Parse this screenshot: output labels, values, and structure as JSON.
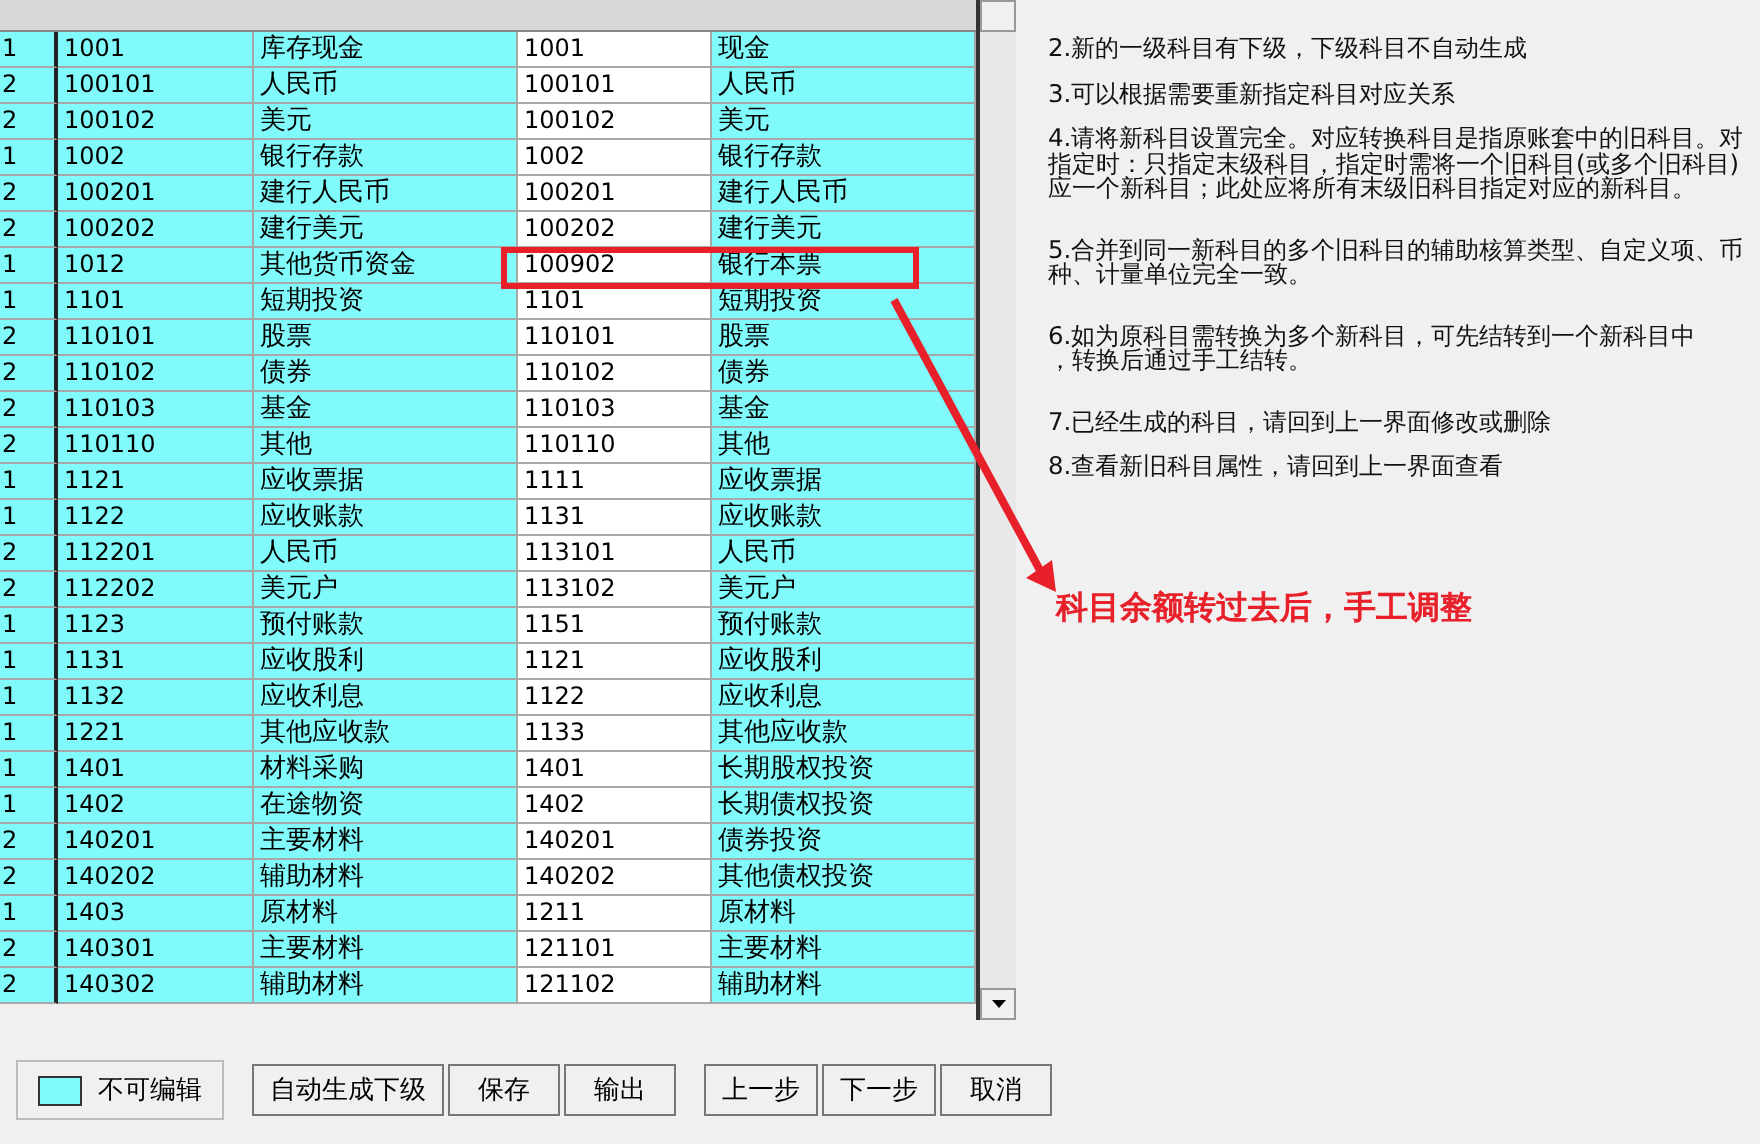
{
  "table": {
    "rows": [
      {
        "level": "1",
        "old_code": "1001",
        "old_name": "库存现金",
        "new_code": "1001",
        "new_name": "现金",
        "highlighted": false
      },
      {
        "level": "2",
        "old_code": "100101",
        "old_name": "人民币",
        "new_code": "100101",
        "new_name": "人民币",
        "highlighted": false
      },
      {
        "level": "2",
        "old_code": "100102",
        "old_name": "美元",
        "new_code": "100102",
        "new_name": "美元",
        "highlighted": false
      },
      {
        "level": "1",
        "old_code": "1002",
        "old_name": "银行存款",
        "new_code": "1002",
        "new_name": "银行存款",
        "highlighted": false
      },
      {
        "level": "2",
        "old_code": "100201",
        "old_name": "建行人民币",
        "new_code": "100201",
        "new_name": "建行人民币",
        "highlighted": false
      },
      {
        "level": "2",
        "old_code": "100202",
        "old_name": "建行美元",
        "new_code": "100202",
        "new_name": "建行美元",
        "highlighted": false
      },
      {
        "level": "1",
        "old_code": "1012",
        "old_name": "其他货币资金",
        "new_code": "100902",
        "new_name": "银行本票",
        "highlighted": true
      },
      {
        "level": "1",
        "old_code": "1101",
        "old_name": "短期投资",
        "new_code": "1101",
        "new_name": "短期投资",
        "highlighted": false
      },
      {
        "level": "2",
        "old_code": "110101",
        "old_name": "股票",
        "new_code": "110101",
        "new_name": "股票",
        "highlighted": false
      },
      {
        "level": "2",
        "old_code": "110102",
        "old_name": "债券",
        "new_code": "110102",
        "new_name": "债券",
        "highlighted": false
      },
      {
        "level": "2",
        "old_code": "110103",
        "old_name": "基金",
        "new_code": "110103",
        "new_name": "基金",
        "highlighted": false
      },
      {
        "level": "2",
        "old_code": "110110",
        "old_name": "其他",
        "new_code": "110110",
        "new_name": "其他",
        "highlighted": false
      },
      {
        "level": "1",
        "old_code": "1121",
        "old_name": "应收票据",
        "new_code": "1111",
        "new_name": "应收票据",
        "highlighted": false
      },
      {
        "level": "1",
        "old_code": "1122",
        "old_name": "应收账款",
        "new_code": "1131",
        "new_name": "应收账款",
        "highlighted": false
      },
      {
        "level": "2",
        "old_code": "112201",
        "old_name": "人民币",
        "new_code": "113101",
        "new_name": "人民币",
        "highlighted": false
      },
      {
        "level": "2",
        "old_code": "112202",
        "old_name": "美元户",
        "new_code": "113102",
        "new_name": "美元户",
        "highlighted": false
      },
      {
        "level": "1",
        "old_code": "1123",
        "old_name": "预付账款",
        "new_code": "1151",
        "new_name": "预付账款",
        "highlighted": false
      },
      {
        "level": "1",
        "old_code": "1131",
        "old_name": "应收股利",
        "new_code": "1121",
        "new_name": "应收股利",
        "highlighted": false
      },
      {
        "level": "1",
        "old_code": "1132",
        "old_name": "应收利息",
        "new_code": "1122",
        "new_name": "应收利息",
        "highlighted": false
      },
      {
        "level": "1",
        "old_code": "1221",
        "old_name": "其他应收款",
        "new_code": "1133",
        "new_name": "其他应收款",
        "highlighted": false
      },
      {
        "level": "1",
        "old_code": "1401",
        "old_name": "材料采购",
        "new_code": "1401",
        "new_name": "长期股权投资",
        "highlighted": false
      },
      {
        "level": "1",
        "old_code": "1402",
        "old_name": "在途物资",
        "new_code": "1402",
        "new_name": "长期债权投资",
        "highlighted": false
      },
      {
        "level": "2",
        "old_code": "140201",
        "old_name": "主要材料",
        "new_code": "140201",
        "new_name": "债券投资",
        "highlighted": false
      },
      {
        "level": "2",
        "old_code": "140202",
        "old_name": "辅助材料",
        "new_code": "140202",
        "new_name": "其他债权投资",
        "highlighted": false
      },
      {
        "level": "1",
        "old_code": "1403",
        "old_name": "原材料",
        "new_code": "1211",
        "new_name": "原材料",
        "highlighted": false
      },
      {
        "level": "2",
        "old_code": "140301",
        "old_name": "主要材料",
        "new_code": "121101",
        "new_name": "主要材料",
        "highlighted": false
      },
      {
        "level": "2",
        "old_code": "140302",
        "old_name": "辅助材料",
        "new_code": "121102",
        "new_name": "辅助材料",
        "highlighted": false
      }
    ]
  },
  "notes": [
    {
      "lines": [
        "2.新的一级科目有下级，下级科目不自动生成"
      ]
    },
    {
      "lines": [
        "3.可以根据需要重新指定科目对应关系"
      ]
    },
    {
      "lines": [
        "4.请将新科目设置完全。对应转换科目是指原账套中的旧科目。对",
        "指定时：只指定末级科目，指定时需将一个旧科目(或多个旧科目)",
        "应一个新科目；此处应将所有末级旧科目指定对应的新科目。"
      ]
    },
    {
      "lines": [
        "5.合并到同一新科目的多个旧科目的辅助核算类型、自定义项、币",
        "种、计量单位完全一致。"
      ]
    },
    {
      "lines": [
        "6.如为原科目需转换为多个新科目，可先结转到一个新科目中",
        "，转换后通过手工结转。"
      ]
    },
    {
      "lines": [
        "7.已经生成的科目，请回到上一界面修改或删除"
      ]
    },
    {
      "lines": [
        "8.查看新旧科目属性，请回到上一界面查看"
      ]
    }
  ],
  "annotation": {
    "text": "科目余额转过去后，手工调整"
  },
  "legend": {
    "label": "不可编辑"
  },
  "buttons": [
    "自动生成下级",
    "保存",
    "输出",
    "上一步",
    "下一步",
    "取消"
  ]
}
